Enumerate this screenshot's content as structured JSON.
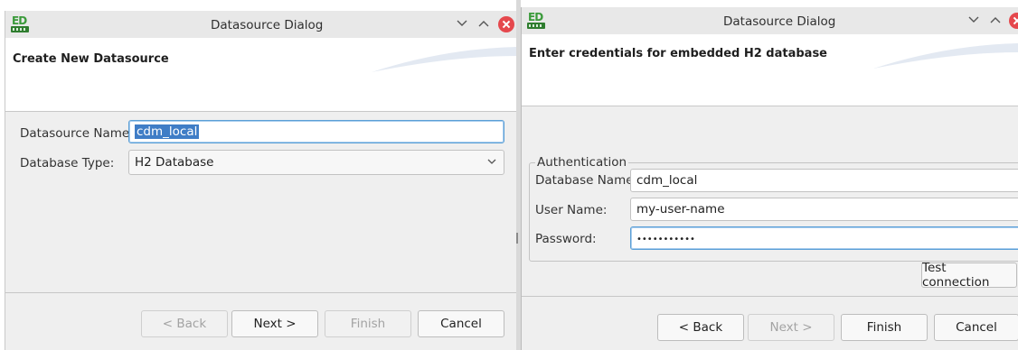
{
  "left_dialog": {
    "title": "Datasource Dialog",
    "heading": "Create New Datasource",
    "datasource_name_label": "Datasource Name:",
    "datasource_name_value": "cdm_local",
    "database_type_label": "Database Type:",
    "database_type_value": "H2 Database",
    "buttons": {
      "back": "< Back",
      "next": "Next >",
      "finish": "Finish",
      "cancel": "Cancel"
    }
  },
  "right_dialog": {
    "title": "Datasource Dialog",
    "heading": "Enter credentials for embedded H2 database",
    "group_title": "Authentication",
    "database_name_label": "Database Name:",
    "database_name_value": "cdm_local",
    "user_name_label": "User Name:",
    "user_name_value": "my-user-name",
    "password_label": "Password:",
    "password_value": "•••••••••••",
    "test_connection": "Test connection",
    "buttons": {
      "back": "< Back",
      "next": "Next >",
      "finish": "Finish",
      "cancel": "Cancel"
    }
  },
  "icons": {
    "app_logo": "ed-logo-icon",
    "minimize": "chevron-down-icon",
    "maximize": "chevron-up-icon",
    "close": "close-icon",
    "dropdown": "chevron-down-icon"
  },
  "colors": {
    "close_button": "#e5484d",
    "selection": "#3f7dc6",
    "focus_border": "#5a9fd6",
    "logo_green": "#3a9a3a"
  }
}
